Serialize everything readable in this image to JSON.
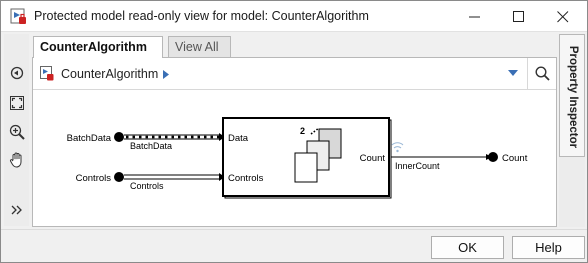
{
  "window": {
    "title": "Protected model read-only view for model: CounterAlgorithm"
  },
  "tabs": [
    {
      "label": "CounterAlgorithm",
      "active": true
    },
    {
      "label": "View All",
      "active": false
    }
  ],
  "pathbar": {
    "model_name": "CounterAlgorithm"
  },
  "left_toolbar": [
    {
      "icon": "navigate-back-icon"
    },
    {
      "icon": "fit-to-view-icon"
    },
    {
      "icon": "zoom-icon"
    },
    {
      "icon": "pan-hand-icon"
    },
    {
      "icon": "expand-toolbar-icon"
    }
  ],
  "diagram": {
    "inports": [
      {
        "name": "BatchData",
        "signal": "BatchData"
      },
      {
        "name": "Controls",
        "signal": "Controls"
      }
    ],
    "subsystem": {
      "input_ports": [
        "Data",
        "Controls"
      ],
      "output_port": "Count",
      "badge": "2"
    },
    "output_signal": "InnerCount",
    "outport": {
      "name": "Count"
    }
  },
  "right_panel": {
    "tab_label": "Property Inspector"
  },
  "buttons": {
    "ok": "OK",
    "help": "Help"
  },
  "colors": {
    "accent_red": "#cc2222",
    "canvas_bg": "#ffffff",
    "window_bg": "#f0f0f0"
  }
}
